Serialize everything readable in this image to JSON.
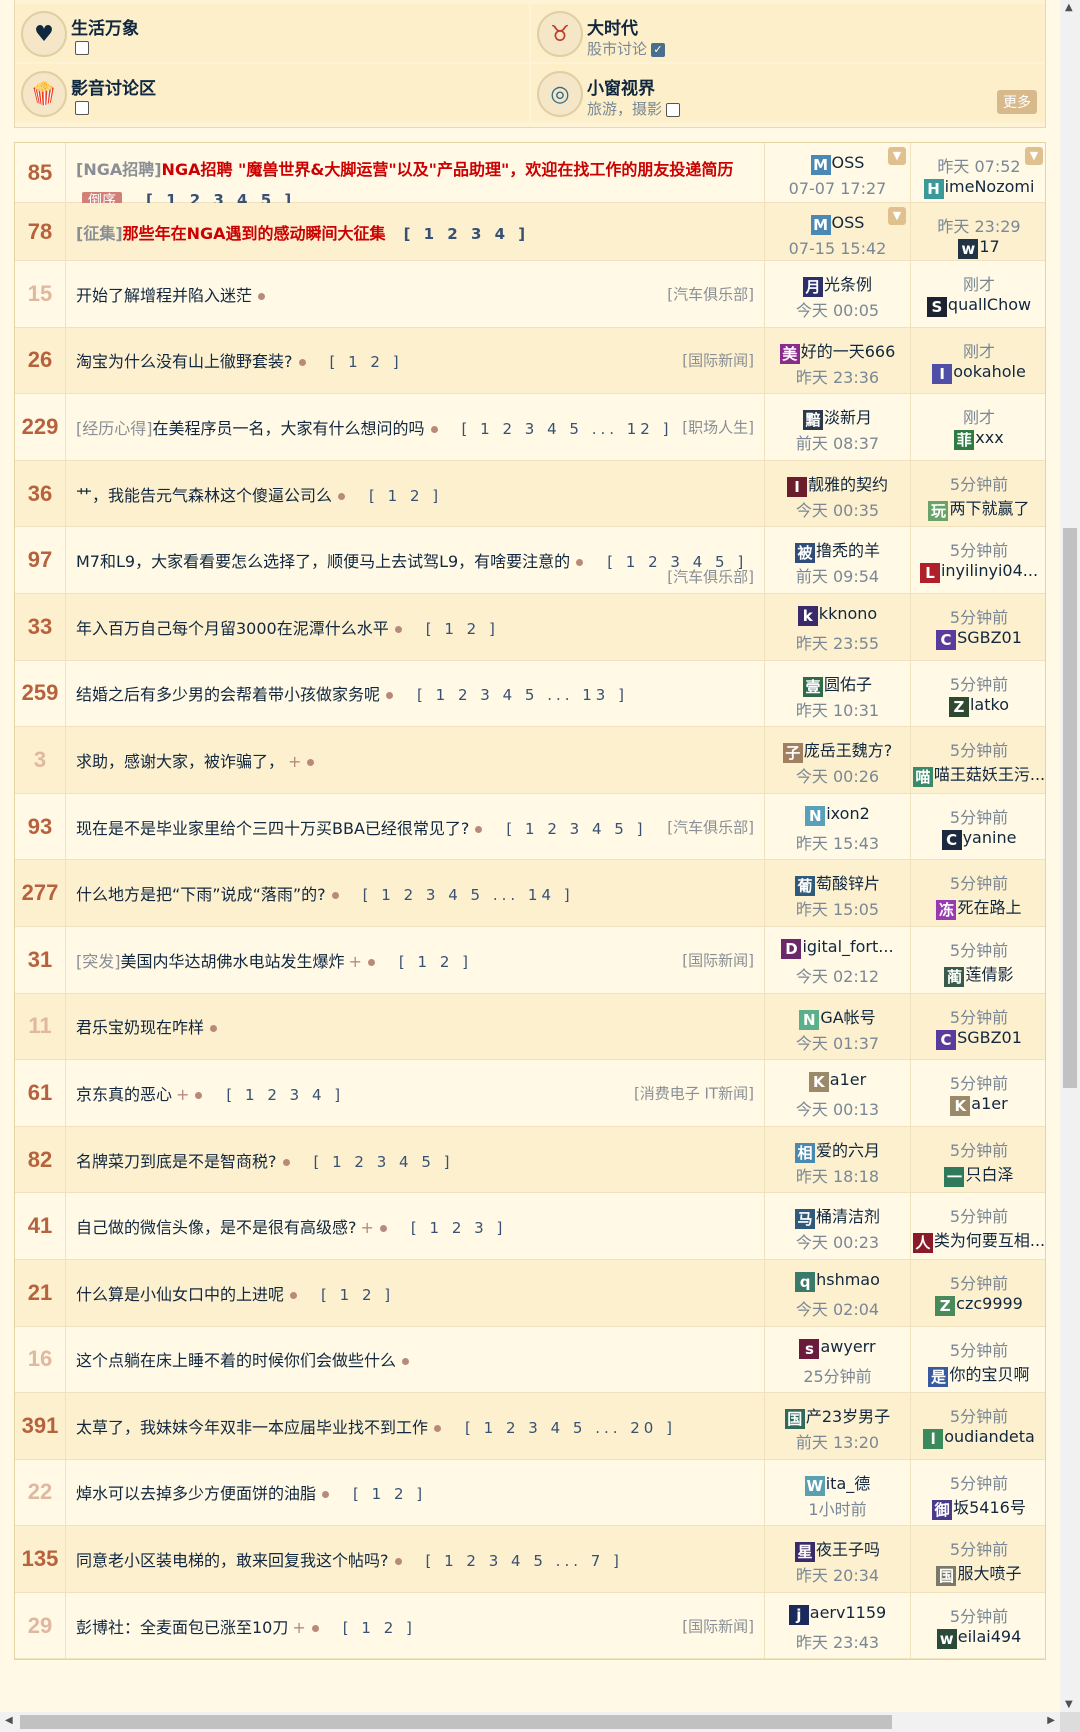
{
  "forums": {
    "more_label": "更多",
    "items": [
      {
        "name": "生活万象",
        "desc": "",
        "checked": false,
        "icon": "heart-tag-icon"
      },
      {
        "name": "大时代",
        "desc": "股市讨论",
        "checked": true,
        "icon": "bull-icon"
      },
      {
        "name": "影音讨论区",
        "desc": "",
        "checked": false,
        "icon": "popcorn-icon"
      },
      {
        "name": "小窗视界",
        "desc": "旅游，摄影",
        "checked": false,
        "icon": "aperture-icon"
      }
    ]
  },
  "topics": [
    {
      "replies": "85",
      "tag": "[NGA招聘]",
      "title": "NGA招聘 \"魔兽世界&大脚运营\"以及\"产品助理\"，欢迎在找工作的朋友投递简历",
      "red": true,
      "order": "倒序",
      "pages": "[ 1 2 3 4 5 ]",
      "forum": "",
      "author": "MOSS",
      "author_initial": "M",
      "author_rest": "OSS",
      "author_color": "#4a89b5",
      "post_time": "07-07 17:27",
      "last_time": "昨天 07:52",
      "last_user_initial": "H",
      "last_user_rest": "imeNozomi",
      "last_color": "#3a9a9a"
    },
    {
      "replies": "78",
      "tag": "[征集]",
      "title": "那些年在NGA遇到的感动瞬间大征集",
      "red": true,
      "order": "",
      "pages": "[ 1 2 3 4 ]",
      "forum": "",
      "author": "MOSS",
      "author_initial": "M",
      "author_rest": "OSS",
      "author_color": "#4a89b5",
      "post_time": "07-15 15:42",
      "last_time": "昨天 23:29",
      "last_user_initial": "w",
      "last_user_rest": "17",
      "last_color": "#234"
    },
    {
      "replies": "15",
      "tag": "",
      "title": "开始了解增程并陷入迷茫",
      "dot": true,
      "pages": "",
      "forum": "[汽车俱乐部]",
      "author_initial": "月",
      "author_rest": "光条例",
      "author_color": "#2d2f6b",
      "post_time": "今天 00:05",
      "last_time": "刚才",
      "last_user_initial": "S",
      "last_user_rest": "quallChow",
      "last_color": "#1c2230",
      "dim": true
    },
    {
      "replies": "26",
      "tag": "",
      "title": "淘宝为什么没有山上徹野套装?",
      "dot": true,
      "pages": "[ 1 2 ]",
      "forum": "[国际新闻]",
      "author_initial": "美",
      "author_rest": "好的一天666",
      "author_color": "#8a2c8c",
      "post_time": "昨天 23:36",
      "last_time": "刚才",
      "last_user_initial": "I",
      "last_user_rest": "ookahole",
      "last_color": "#4f4fa8"
    },
    {
      "replies": "229",
      "tag": "[经历心得]",
      "title": "在美程序员一名，大家有什么想问的吗",
      "dot": true,
      "pages": "[ 1 2 3 4 5 ... 12 ]",
      "forum": "[职场人生]",
      "author_initial": "黯",
      "author_rest": "淡新月",
      "author_color": "#2d3a4b",
      "post_time": "前天 08:37",
      "last_time": "刚才",
      "last_user_initial": "菲",
      "last_user_rest": "xxx",
      "last_color": "#2f7a43"
    },
    {
      "replies": "36",
      "tag": "",
      "title": "艹，我能告元气森林这个傻逼公司么",
      "dot": true,
      "pages": "[ 1 2 ]",
      "forum": "",
      "author_initial": "I",
      "author_rest": "靓雅的契约",
      "author_color": "#6b1d2b",
      "post_time": "今天 00:35",
      "last_time": "5分钟前",
      "last_user_initial": "玩",
      "last_user_rest": "两下就赢了",
      "last_color": "#6aa36a"
    },
    {
      "replies": "97",
      "tag": "",
      "title": "M7和L9，大家看看要怎么选择了，顺便马上去试驾L9，有啥要注意的",
      "dot": true,
      "pages": "[ 1 2 3 4 5 ]",
      "forum": "[汽车俱乐部]",
      "forum_low": true,
      "author_initial": "被",
      "author_rest": "撸秃的羊",
      "author_color": "#2f4e7a",
      "post_time": "前天 09:54",
      "last_time": "5分钟前",
      "last_user_initial": "L",
      "last_user_rest": "inyilinyi04...",
      "last_color": "#b0202a"
    },
    {
      "replies": "33",
      "tag": "",
      "title": "年入百万自己每个月留3000在泥潭什么水平",
      "dot": true,
      "pages": "[ 1 2 ]",
      "forum": "",
      "author_initial": "k",
      "author_rest": "kknono",
      "author_color": "#3a2a6b",
      "post_time": "昨天 23:55",
      "last_time": "5分钟前",
      "last_user_initial": "C",
      "last_user_rest": "SGBZ01",
      "last_color": "#5a3a9a"
    },
    {
      "replies": "259",
      "tag": "",
      "title": "结婚之后有多少男的会帮着带小孩做家务呢",
      "dot": true,
      "pages": "[ 1 2 3 4 5 ... 13 ]",
      "forum": "",
      "author_initial": "壹",
      "author_rest": "圆佑子",
      "author_color": "#2f6b4a",
      "post_time": "昨天 10:31",
      "last_time": "5分钟前",
      "last_user_initial": "Z",
      "last_user_rest": "latko",
      "last_color": "#2f4a2f"
    },
    {
      "replies": "3",
      "tag": "",
      "title": "求助，感谢大家，被诈骗了，",
      "plus": true,
      "dot": true,
      "pages": "",
      "forum": "",
      "author_initial": "子",
      "author_rest": "庞岳王魏方?",
      "author_color": "#a08060",
      "post_time": "今天 00:26",
      "last_time": "5分钟前",
      "last_user_initial": "喵",
      "last_user_rest": "喵王菇妖王污...",
      "last_color": "#3a8a6a",
      "dim": true
    },
    {
      "replies": "93",
      "tag": "",
      "title": "现在是不是毕业家里给个三四十万买BBA已经很常见了?",
      "dot": true,
      "pages": "[ 1 2 3 4 5 ]",
      "forum": "[汽车俱乐部]",
      "author_initial": "N",
      "author_rest": "ixon2",
      "author_color": "#5aa0b8",
      "post_time": "昨天 15:43",
      "last_time": "5分钟前",
      "last_user_initial": "C",
      "last_user_rest": "yanine",
      "last_color": "#1c2a40"
    },
    {
      "replies": "277",
      "tag": "",
      "title": "什么地方是把“下雨”说成“落雨”的?",
      "dot": true,
      "pages": "[ 1 2 3 4 5 ... 14 ]",
      "forum": "",
      "author_initial": "葡",
      "author_rest": "萄酸锌片",
      "author_color": "#2f5a7a",
      "post_time": "昨天 15:05",
      "last_time": "5分钟前",
      "last_user_initial": "冻",
      "last_user_rest": "死在路上",
      "last_color": "#9a3ab0"
    },
    {
      "replies": "31",
      "tag": "[突发]",
      "title": "美国内华达胡佛水电站发生爆炸",
      "plus": true,
      "dot": true,
      "pages": "[ 1 2 ]",
      "forum": "[国际新闻]",
      "author_initial": "D",
      "author_rest": "igital_fort...",
      "author_color": "#6a2a6a",
      "post_time": "今天 02:12",
      "last_time": "5分钟前",
      "last_user_initial": "蔺",
      "last_user_rest": "莲倩影",
      "last_color": "#3a5a4a"
    },
    {
      "replies": "11",
      "tag": "",
      "title": "君乐宝奶现在咋样",
      "dot": true,
      "pages": "",
      "forum": "",
      "author_initial": "N",
      "author_rest": "GA帐号",
      "author_color": "#5ab08a",
      "post_time": "今天 01:37",
      "last_time": "5分钟前",
      "last_user_initial": "C",
      "last_user_rest": "SGBZ01",
      "last_color": "#5a3a9a",
      "dim": true
    },
    {
      "replies": "61",
      "tag": "",
      "title": "京东真的恶心",
      "plus": true,
      "dot": true,
      "pages": "[ 1 2 3 4 ]",
      "forum": "[消费电子 IT新闻]",
      "author_initial": "K",
      "author_rest": "a1er",
      "author_color": "#9a8a6a",
      "post_time": "今天 00:13",
      "last_time": "5分钟前",
      "last_user_initial": "K",
      "last_user_rest": "a1er",
      "last_color": "#9a8a6a"
    },
    {
      "replies": "82",
      "tag": "",
      "title": "名牌菜刀到底是不是智商税?",
      "dot": true,
      "pages": "[ 1 2 3 4 5 ]",
      "forum": "",
      "author_initial": "相",
      "author_rest": "爱的六月",
      "author_color": "#4a8ab0",
      "post_time": "昨天 18:18",
      "last_time": "5分钟前",
      "last_user_initial": "一",
      "last_user_rest": "只白泽",
      "last_color": "#2f7a5a"
    },
    {
      "replies": "41",
      "tag": "",
      "title": "自己做的微信头像，是不是很有高级感?",
      "plus": true,
      "dot": true,
      "pages": "[ 1 2 3 ]",
      "forum": "",
      "author_initial": "马",
      "author_rest": "桶清洁剂",
      "author_color": "#2f5a7a",
      "post_time": "今天 00:23",
      "last_time": "5分钟前",
      "last_user_initial": "人",
      "last_user_rest": "类为何要互相...",
      "last_color": "#8a1a2a"
    },
    {
      "replies": "21",
      "tag": "",
      "title": "什么算是小仙女口中的上进呢",
      "dot": true,
      "pages": "[ 1 2 ]",
      "forum": "",
      "author_initial": "q",
      "author_rest": "hshmao",
      "author_color": "#3a7a6a",
      "post_time": "今天 02:04",
      "last_time": "5分钟前",
      "last_user_initial": "Z",
      "last_user_rest": "czc9999",
      "last_color": "#4a8a5a"
    },
    {
      "replies": "16",
      "tag": "",
      "title": "这个点躺在床上睡不着的时候你们会做些什么",
      "dot": true,
      "pages": "",
      "forum": "",
      "author_initial": "s",
      "author_rest": "awyerr",
      "author_color": "#6a1a3a",
      "post_time": "25分钟前",
      "last_time": "5分钟前",
      "last_user_initial": "是",
      "last_user_rest": "你的宝贝啊",
      "last_color": "#3a5aa0",
      "dim": true
    },
    {
      "replies": "391",
      "tag": "",
      "title": "太草了，我妹妹今年双非一本应届毕业找不到工作",
      "dot": true,
      "pages": "[ 1 2 3 4 5 ... 20 ]",
      "forum": "",
      "author_initial": "国",
      "author_rest": "产23岁男子",
      "author_color": "#2f6a5a",
      "post_time": "前天 13:20",
      "last_time": "5分钟前",
      "last_user_initial": "l",
      "last_user_rest": "oudiandeta",
      "last_color": "#3a8a5a"
    },
    {
      "replies": "22",
      "tag": "",
      "title": "焯水可以去掉多少方便面饼的油脂",
      "dot": true,
      "pages": "[ 1 2 ]",
      "forum": "",
      "author_initial": "W",
      "author_rest": "ita_德",
      "author_color": "#5aa0b0",
      "post_time": "1小时前",
      "last_time": "5分钟前",
      "last_user_initial": "御",
      "last_user_rest": "坂5416号",
      "last_color": "#4a3a8a",
      "dim": true
    },
    {
      "replies": "135",
      "tag": "",
      "title": "同意老小区装电梯的，敢来回复我这个帖吗?",
      "dot": true,
      "pages": "[ 1 2 3 4 5 ... 7 ]",
      "forum": "",
      "author_initial": "星",
      "author_rest": "夜王子吗",
      "author_color": "#3a2a6a",
      "post_time": "昨天 20:34",
      "last_time": "5分钟前",
      "last_user_initial": "国",
      "last_user_rest": "服大喷子",
      "last_color": "#7a7a6a"
    },
    {
      "replies": "29",
      "tag": "",
      "title": "彭博社：全麦面包已涨至10刀",
      "plus": true,
      "dot": true,
      "pages": "[ 1 2 ]",
      "forum": "[国际新闻]",
      "author_initial": "j",
      "author_rest": "aerv1159",
      "author_color": "#1a2a5a",
      "post_time": "昨天 23:43",
      "last_time": "5分钟前",
      "last_user_initial": "w",
      "last_user_rest": "eilai494",
      "last_color": "#2a4a3a",
      "dim": true
    }
  ]
}
